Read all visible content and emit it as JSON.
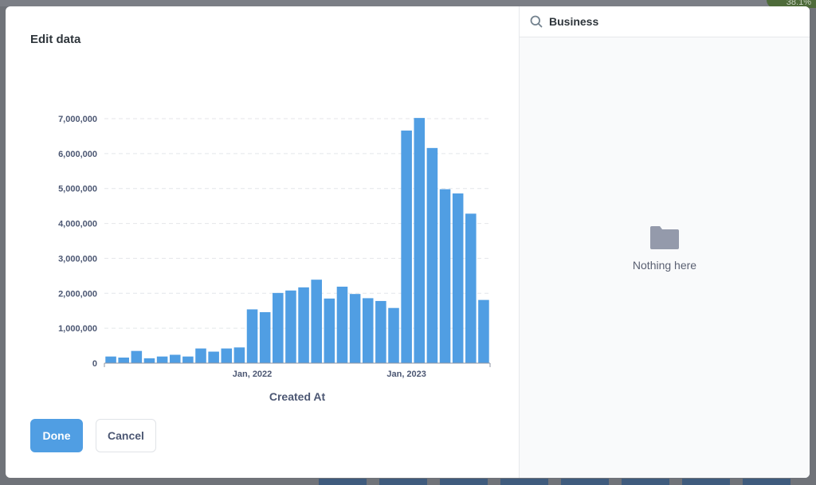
{
  "modal": {
    "title": "Edit data",
    "done_label": "Done",
    "cancel_label": "Cancel"
  },
  "search": {
    "value": "Business"
  },
  "empty_state": {
    "text": "Nothing here"
  },
  "background": {
    "corner_text": "38.1%"
  },
  "colors": {
    "bar": "#509ee3",
    "primary": "#509ee3",
    "text_dark": "#2e353b",
    "text_medium": "#4c5773"
  },
  "icons": {
    "search": "search-icon",
    "folder": "folder-icon"
  },
  "chart_data": {
    "type": "bar",
    "xlabel": "Created At",
    "ylabel": "",
    "ylim": [
      0,
      7000000
    ],
    "yticks": [
      0,
      1000000,
      2000000,
      3000000,
      4000000,
      5000000,
      6000000,
      7000000
    ],
    "ytick_labels": [
      "0",
      "1,000,000",
      "2,000,000",
      "3,000,000",
      "4,000,000",
      "5,000,000",
      "6,000,000",
      "7,000,000"
    ],
    "x_tick_labels": [
      {
        "label": "Jan, 2022",
        "index": 12
      },
      {
        "label": "Jan, 2023",
        "index": 24
      }
    ],
    "grid": true,
    "values": [
      190000,
      160000,
      350000,
      140000,
      190000,
      240000,
      190000,
      420000,
      330000,
      420000,
      450000,
      1540000,
      1460000,
      2010000,
      2080000,
      2170000,
      2390000,
      1850000,
      2190000,
      1980000,
      1860000,
      1780000,
      1580000,
      6660000,
      7020000,
      6160000,
      4980000,
      4860000,
      4280000,
      1810000
    ]
  }
}
